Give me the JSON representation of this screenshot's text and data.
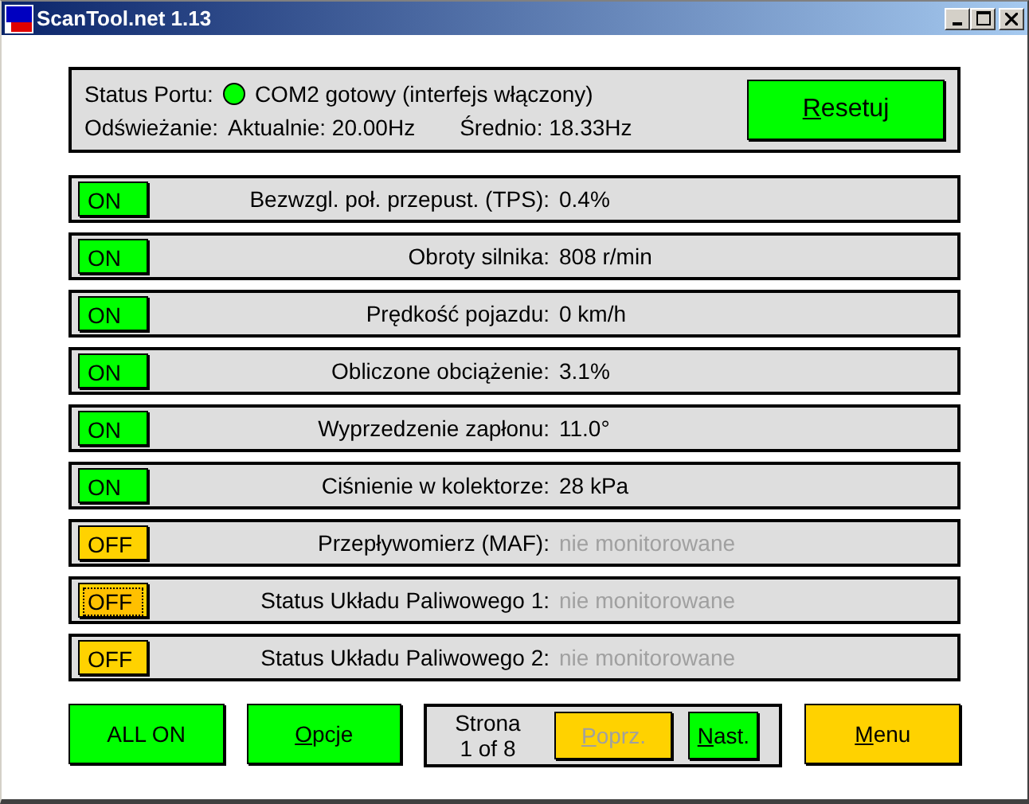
{
  "window": {
    "title": "ScanTool.net 1.13"
  },
  "status": {
    "port_label": "Status Portu:",
    "connected": true,
    "port_text": "COM2 gotowy (interfejs włączony)",
    "refresh_label": "Odświeżanie:",
    "current": "Aktualnie: 20.00Hz",
    "average": "Średnio: 18.33Hz",
    "reset": {
      "label": "Resetuj",
      "mnemonic": true
    }
  },
  "sensors": [
    {
      "on": true,
      "toggle": "ON",
      "focused": false,
      "label": "Bezwzgl. poł. przepust. (TPS):",
      "value": "0.4%"
    },
    {
      "on": true,
      "toggle": "ON",
      "focused": false,
      "label": "Obroty silnika:",
      "value": "808 r/min"
    },
    {
      "on": true,
      "toggle": "ON",
      "focused": false,
      "label": "Prędkość pojazdu:",
      "value": "0 km/h"
    },
    {
      "on": true,
      "toggle": "ON",
      "focused": false,
      "label": "Obliczone obciążenie:",
      "value": "3.1%"
    },
    {
      "on": true,
      "toggle": "ON",
      "focused": false,
      "label": "Wyprzedzenie zapłonu:",
      "value": "11.0°"
    },
    {
      "on": true,
      "toggle": "ON",
      "focused": false,
      "label": "Ciśnienie w kolektorze:",
      "value": "28 kPa"
    },
    {
      "on": false,
      "toggle": "OFF",
      "focused": false,
      "label": "Przepływomierz (MAF):",
      "value": "nie monitorowane"
    },
    {
      "on": false,
      "toggle": "OFF",
      "focused": true,
      "label": "Status Układu Paliwowego 1:",
      "value": "nie monitorowane"
    },
    {
      "on": false,
      "toggle": "OFF",
      "focused": false,
      "label": "Status Układu Paliwowego 2:",
      "value": "nie monitorowane"
    }
  ],
  "footer": {
    "all_on": {
      "label": "ALL  ON",
      "mnemonic": false
    },
    "options": {
      "label": "Opcje",
      "mnemonic": true
    },
    "page_label": "Strona",
    "page_number": "1 of 8",
    "prev": {
      "label": "Poprz.",
      "mnemonic": true,
      "disabled": true
    },
    "next": {
      "label": "Nast.",
      "mnemonic": true,
      "disabled": false
    },
    "menu": {
      "label": "Menu",
      "mnemonic": true
    }
  }
}
